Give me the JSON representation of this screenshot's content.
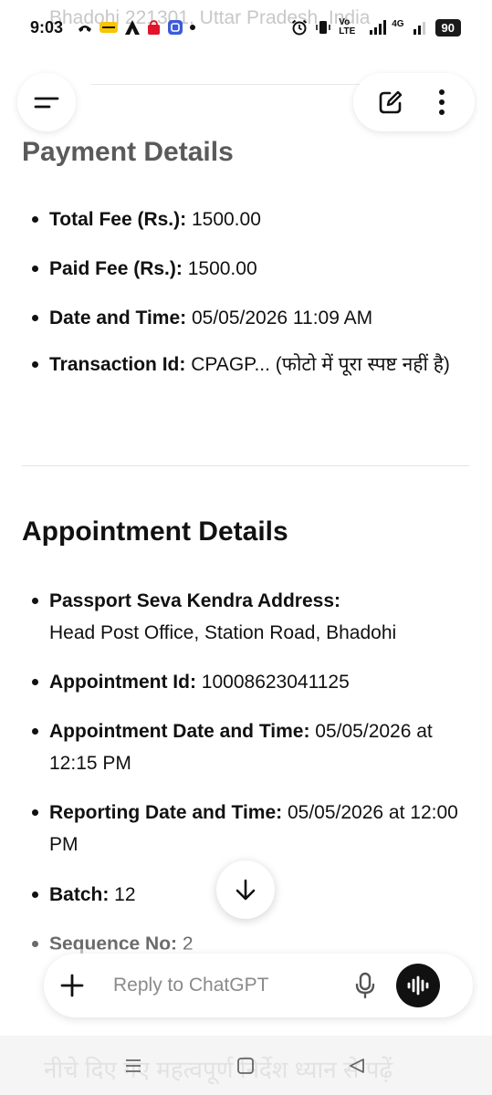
{
  "status_bar": {
    "time": "9:03",
    "background_text": "Bhadohi 221301, Uttar Pradesh, India",
    "battery": "90",
    "network_label": "Vo LTE",
    "signal_label": "4G"
  },
  "top_bar": {
    "menu_icon": "menu-icon",
    "edit_icon": "edit-icon",
    "more_icon": "more-vertical-icon"
  },
  "payment": {
    "heading": "Payment Details",
    "items": [
      {
        "label": "Total Fee (Rs.):",
        "value": " 1500.00"
      },
      {
        "label": "Paid Fee (Rs.):",
        "value": " 1500.00"
      },
      {
        "label": "Date and Time:",
        "value": " 05/05/2026 11:09 AM"
      },
      {
        "label": "Transaction Id:",
        "value": " CPAGP... (फोटो में पूरा स्पष्ट नहीं है)"
      }
    ]
  },
  "appointment": {
    "heading": "Appointment Details",
    "items": [
      {
        "label": "Passport Seva Kendra Address:",
        "value": "Head Post Office, Station Road, Bhadohi"
      },
      {
        "label": "Appointment Id:",
        "value": " 10008623041125"
      },
      {
        "label": "Appointment Date and Time:",
        "value": " 05/05/2026 at 12:15 PM"
      },
      {
        "label": "Reporting Date and Time:",
        "value": " 05/05/2026 at 12:00 PM"
      },
      {
        "label": "Batch:",
        "value": " 12"
      },
      {
        "label": "Sequence No:",
        "value": " 2"
      }
    ]
  },
  "composer": {
    "placeholder": "Reply to ChatGPT"
  },
  "nav_bar": {
    "background_text": "नीचे दिए गए महत्वपूर्ण निर्देश ध्यान से पढ़ें"
  },
  "colors": {
    "text": "#0d0d0d",
    "muted": "#6b6b6b",
    "voice_button": "#111111",
    "background": "#ffffff"
  }
}
